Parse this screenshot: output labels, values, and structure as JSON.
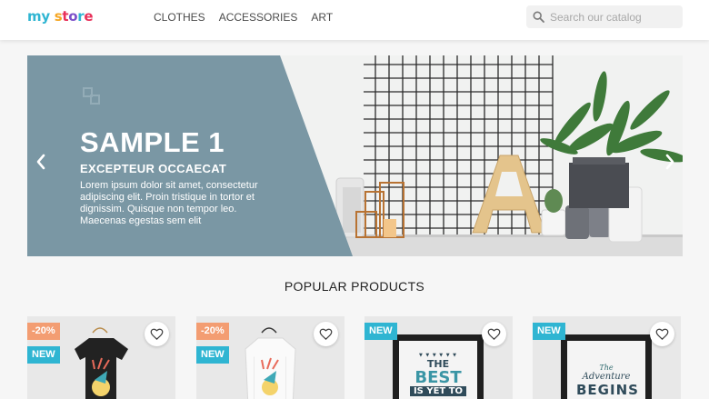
{
  "header": {
    "logo_parts": [
      "my",
      " ",
      "store"
    ],
    "nav": [
      "CLOTHES",
      "ACCESSORIES",
      "ART"
    ],
    "search_placeholder": "Search our catalog"
  },
  "carousel": {
    "title": "SAMPLE 1",
    "subtitle": "EXCEPTEUR OCCAECAT",
    "text": "Lorem ipsum dolor sit amet, consectetur adipiscing elit. Proin tristique in tortor et dignissim. Quisque non tempor leo. Maecenas egestas sem elit"
  },
  "section": {
    "title": "POPULAR PRODUCTS"
  },
  "products": [
    {
      "discount": "-20%",
      "flag": "NEW",
      "image": "black-tshirt-hummingbird"
    },
    {
      "discount": "-20%",
      "flag": "NEW",
      "image": "white-sweater-hummingbird"
    },
    {
      "discount": "",
      "flag": "NEW",
      "image": "framed-poster-the-best-is-yet-to-come",
      "poster_lines": [
        "THE",
        "BEST",
        "IS YET TO"
      ]
    },
    {
      "discount": "",
      "flag": "NEW",
      "image": "framed-poster-the-adventure-begins",
      "poster_lines": [
        "The",
        "Adventure",
        "BEGINS"
      ]
    }
  ],
  "colors": {
    "accent": "#2fb5d2",
    "discount": "#f39d72",
    "caption_panel": "#7a97a4"
  }
}
